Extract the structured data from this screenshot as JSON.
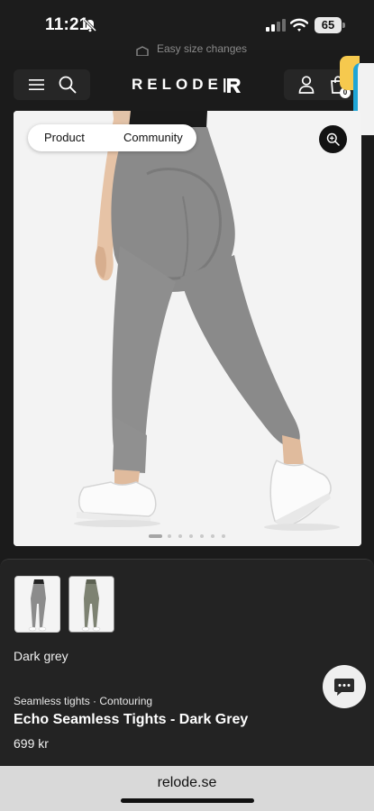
{
  "status_bar": {
    "time": "11:21",
    "battery": "65",
    "icons": [
      "bell-off-icon",
      "signal-icon",
      "wifi-icon",
      "battery-icon"
    ]
  },
  "announcement": {
    "text": "Easy size changes",
    "icon": "box-icon"
  },
  "header": {
    "logo_text": "RELODE|",
    "icons": [
      "menu-icon",
      "search-icon",
      "account-icon",
      "cart-icon"
    ],
    "cart_count": "0"
  },
  "gallery": {
    "tabs": [
      "Product",
      "Community"
    ],
    "active_slide": 1,
    "slide_count": 7,
    "zoom_icon": "zoom-in-icon"
  },
  "product": {
    "color_name": "Dark grey",
    "subtitle": "Seamless tights · Contouring",
    "title": "Echo Seamless Tights - Dark Grey",
    "price": "699 kr",
    "thumbnail_colors": [
      "Dark grey",
      "Olive"
    ]
  },
  "browser": {
    "url": "relode.se"
  },
  "colors": {
    "background": "#1b1b1b",
    "leggings_grey": "#8c8c8c",
    "leggings_olive": "#7d8272",
    "accent_blue": "#1fa5d6",
    "widget_yellow": "#f6c94e"
  }
}
